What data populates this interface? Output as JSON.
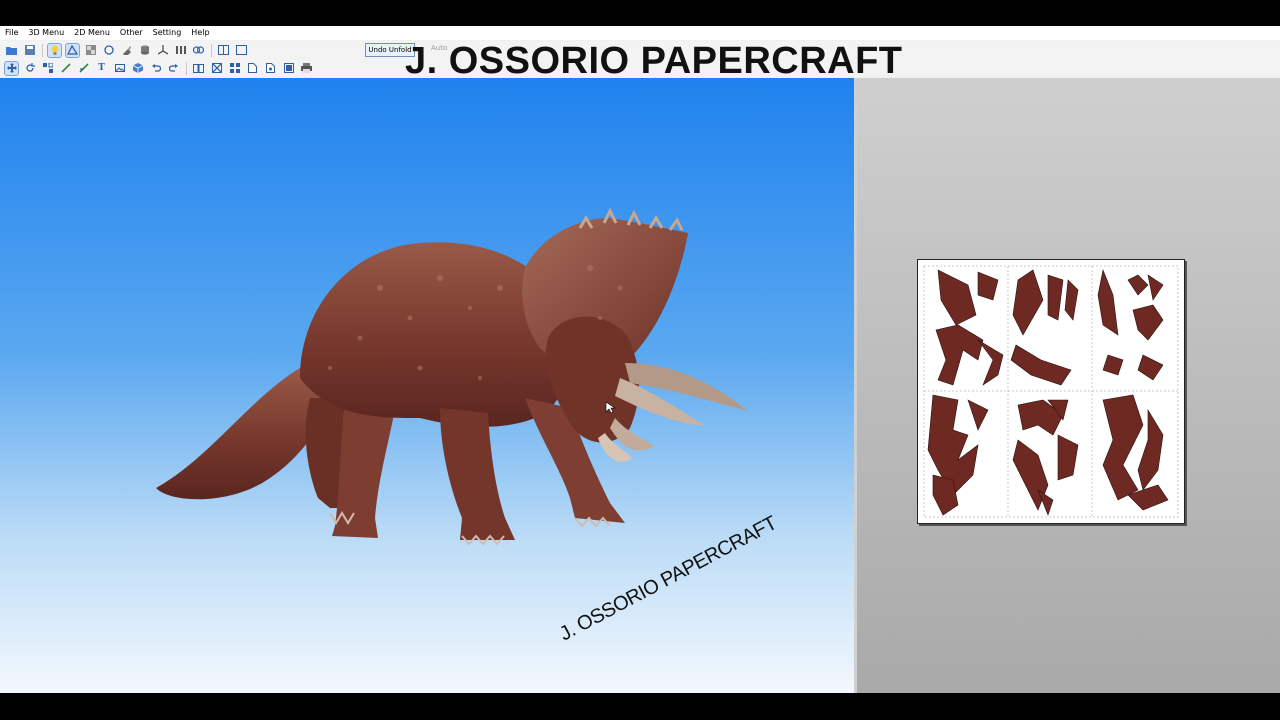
{
  "menu": {
    "items": [
      "File",
      "3D Menu",
      "2D Menu",
      "Other",
      "Setting",
      "Help"
    ]
  },
  "toolbar": {
    "undo_unfold_label": "Undo Unfold",
    "auto_label": "Auto"
  },
  "overlay": {
    "title": "J. OSSORIO PAPERCRAFT"
  },
  "view3d": {
    "model": "triceratops",
    "watermark": "J. OSSORIO PAPERCRAFT",
    "gradient_top": "#1f82ee",
    "gradient_bottom": "#f3f8fd"
  },
  "view2d": {
    "sheet_count": 1,
    "part_color": "#6e2a22"
  }
}
